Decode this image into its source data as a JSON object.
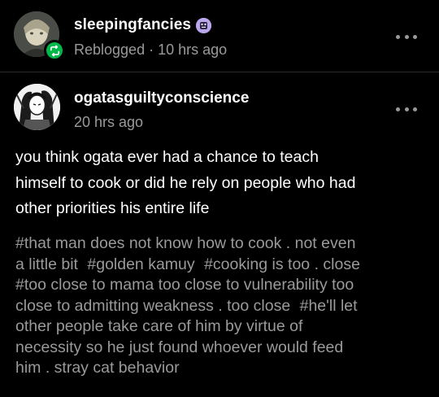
{
  "reblog": {
    "blog_name": "sleepingfancies",
    "meta": "Reblogged · 10 hrs ago",
    "avatar_icon": "user-avatar",
    "badge_icon": "reblog-icon",
    "badge_color": "#00b84a",
    "more_icon": "more-horizontal-icon"
  },
  "original_post": {
    "blog_name": "ogatasguiltyconscience",
    "time": "20 hrs ago",
    "avatar_icon": "user-avatar",
    "more_icon": "more-horizontal-icon",
    "body_lines": [
      "you think ogata ever had a chance to teach",
      "himself to cook or did he rely on people who had",
      "other priorities his entire life"
    ],
    "tag_lines": [
      [
        "#that man does not know how to cook . not even"
      ],
      [
        "a little bit",
        "#golden kamuy",
        "#cooking is too . close"
      ],
      [
        "#too close to mama too close to vulnerability too"
      ],
      [
        "close to admitting weakness . too close",
        "#he'll let"
      ],
      [
        "other people take care of him by virtue of"
      ],
      [
        "necessity so he just found whoever would feed"
      ],
      [
        "him . stray cat behavior"
      ]
    ]
  },
  "colors": {
    "background": "#000000",
    "primary_text": "#ffffff",
    "secondary_text": "#9a9a9a"
  }
}
